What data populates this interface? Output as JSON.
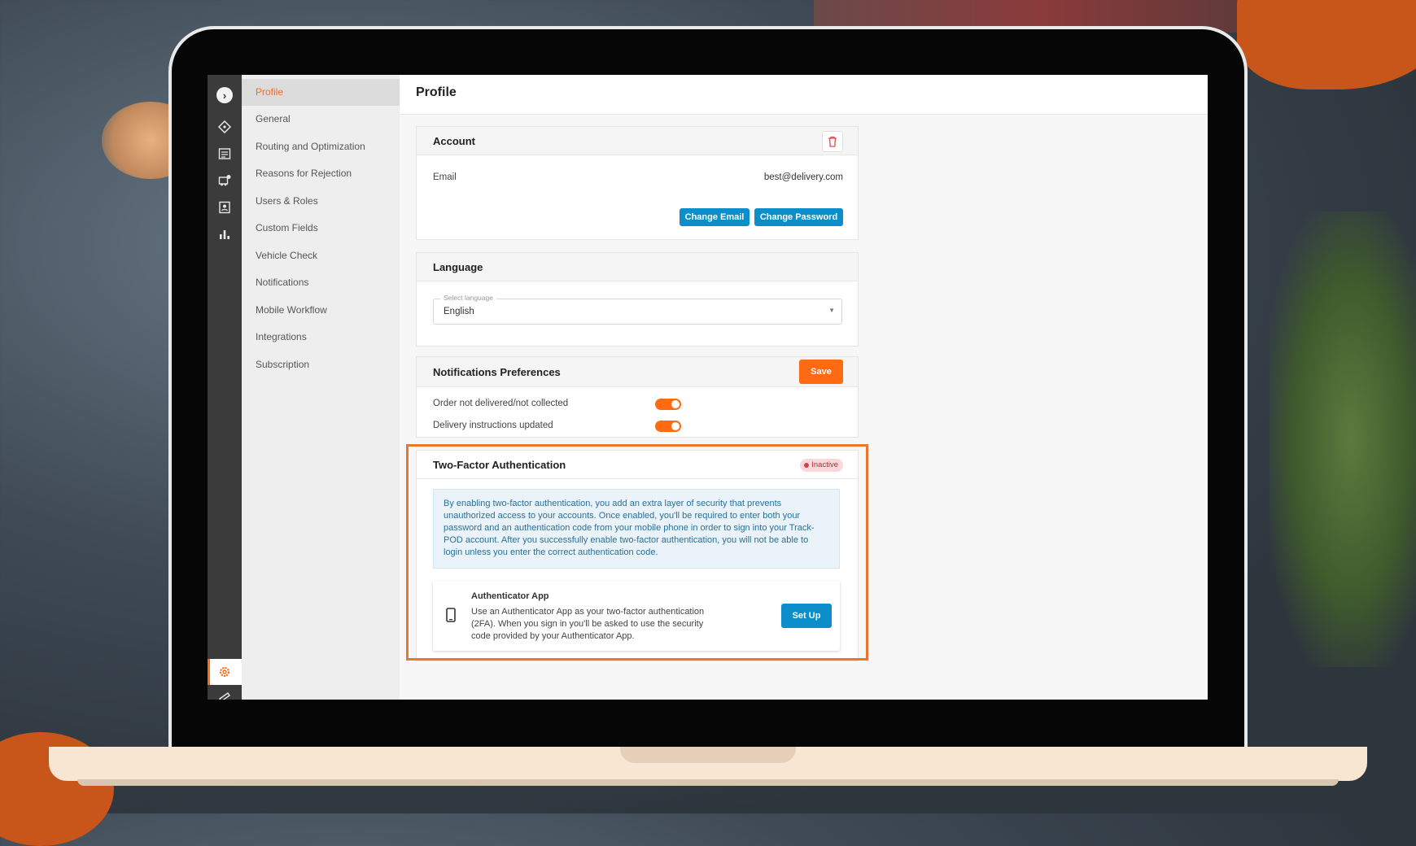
{
  "page": {
    "title": "Profile"
  },
  "submenu": {
    "items": [
      {
        "label": "Profile",
        "selected": true
      },
      {
        "label": "General"
      },
      {
        "label": "Routing and Optimization"
      },
      {
        "label": "Reasons for Rejection"
      },
      {
        "label": "Users & Roles"
      },
      {
        "label": "Custom Fields"
      },
      {
        "label": "Vehicle Check"
      },
      {
        "label": "Notifications"
      },
      {
        "label": "Mobile Workflow"
      },
      {
        "label": "Integrations"
      },
      {
        "label": "Subscription"
      }
    ]
  },
  "rail": {
    "icons": [
      "chevron-right-icon",
      "tag-icon",
      "checklist-icon",
      "vehicle-icon",
      "contacts-icon",
      "bar-chart-icon",
      "gear-icon",
      "vehicle-tilted-icon"
    ],
    "active_icon": "gear-icon"
  },
  "account": {
    "title": "Account",
    "email_label": "Email",
    "email_value": "best@delivery.com",
    "change_email": "Change Email",
    "change_password": "Change Password"
  },
  "language": {
    "title": "Language",
    "select_label": "Select language",
    "selected": "English"
  },
  "notifications": {
    "title": "Notifications Preferences",
    "save": "Save",
    "options": [
      {
        "label": "Order not delivered/not collected",
        "enabled": true
      },
      {
        "label": "Delivery instructions updated",
        "enabled": true
      }
    ]
  },
  "two_factor": {
    "title": "Two-Factor Authentication",
    "status": "Inactive",
    "info": "By enabling two-factor authentication, you add an extra layer of security that prevents unauthorized access to your accounts. Once enabled, you'll be required to enter both your password and an authentication code from your mobile phone in order to sign into your Track-POD account. After you successfully enable two-factor authentication, you will not be able to login unless you enter the correct authentication code.",
    "app_title": "Authenticator App",
    "app_desc": "Use an Authenticator App as your two-factor authentication (2FA). When you sign in you'll be asked to use the security code provided by your Authenticator App.",
    "setup": "Set Up"
  },
  "colors": {
    "accent": "#ff6a13",
    "primary": "#0b8ec9",
    "highlight": "#e87830"
  }
}
